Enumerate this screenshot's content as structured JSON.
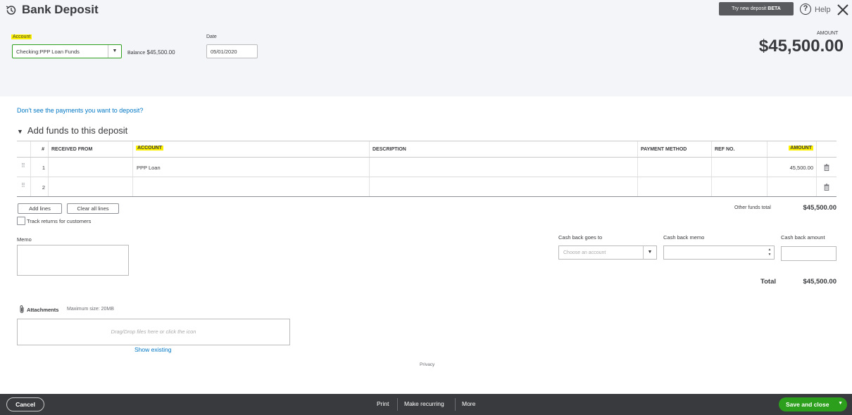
{
  "header": {
    "title": "Bank Deposit",
    "try_new_prefix": "Try new deposit",
    "try_new_badge": "BETA",
    "help_label": "Help",
    "account_label": "Account",
    "account_value": "Checking:PPP Loan Funds",
    "balance_label": "Balance",
    "balance_value": "$45,500.00",
    "date_label": "Date",
    "date_value": "05/01/2020",
    "amount_label": "AMOUNT",
    "amount_value": "$45,500.00"
  },
  "deposit": {
    "dont_see_link": "Don't see the payments you want to deposit?",
    "section_title": "Add funds to this deposit",
    "columns": {
      "num": "#",
      "received_from": "RECEIVED FROM",
      "account": "ACCOUNT",
      "description": "DESCRIPTION",
      "payment_method": "PAYMENT METHOD",
      "ref_no": "REF NO.",
      "amount": "AMOUNT"
    },
    "rows": [
      {
        "num": "1",
        "received_from": "",
        "account": "PPP Loan",
        "description": "",
        "payment_method": "",
        "ref_no": "",
        "amount": "45,500.00"
      },
      {
        "num": "2",
        "received_from": "",
        "account": "",
        "description": "",
        "payment_method": "",
        "ref_no": "",
        "amount": ""
      }
    ],
    "add_lines": "Add lines",
    "clear_all_lines": "Clear all lines",
    "other_funds_total_label": "Other funds total",
    "other_funds_total_value": "$45,500.00",
    "track_returns_label": "Track returns for customers"
  },
  "memo": {
    "label": "Memo"
  },
  "cashback": {
    "goes_to_label": "Cash back goes to",
    "goes_to_placeholder": "Choose an account",
    "memo_label": "Cash back memo",
    "amount_label": "Cash back amount"
  },
  "totals": {
    "total_label": "Total",
    "total_value": "$45,500.00"
  },
  "attachments": {
    "label": "Attachments",
    "max_size": "Maximum size: 20MB",
    "drop_hint": "Drag/Drop files here or click the icon",
    "show_existing": "Show existing"
  },
  "privacy": "Privacy",
  "footer": {
    "cancel": "Cancel",
    "print": "Print",
    "make_recurring": "Make recurring",
    "more": "More",
    "save_and_close": "Save and close"
  },
  "colors": {
    "accent_green": "#2ca01c",
    "link_blue": "#0077c5",
    "highlight": "#fff200",
    "footer_bg": "#393a3d"
  }
}
